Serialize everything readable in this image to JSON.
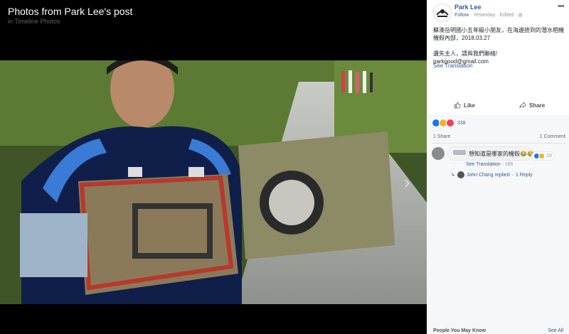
{
  "viewer": {
    "title": "Photos from Park Lee's post",
    "subtitle": "in Timeline Photos",
    "next_icon": "chevron-right-icon"
  },
  "post": {
    "author": "Park Lee",
    "follow": "Follow",
    "time": "Yesterday",
    "edited": "Edited",
    "privacy_icon": "globe-icon",
    "text": "蘇澳岳明國小五年級小朋友，在海邊撿到的潛水相機機殼內部，2018.03.27\n\n遺失主人，請與我們聯絡!\nparkgood@gmail.com",
    "see_translation": "See Translation",
    "like_label": "Like",
    "share_label": "Share",
    "reaction_count": "338",
    "share_count": "1 Share",
    "comment_count": "1 Comment"
  },
  "comment": {
    "text": "想知道是哪家的機殼😂😂",
    "see_translation": "See Translation",
    "time": "16h",
    "reaction_count": "19",
    "reply_line": "John Chang replied",
    "reply_count": "1 Reply"
  },
  "sidebar_footer": {
    "people_label": "People You May Know",
    "see_all": "See All"
  },
  "colors": {
    "link": "#365899",
    "like_blue": "#1877f2",
    "haha_yellow": "#f7b125",
    "love_red": "#f33e58"
  }
}
